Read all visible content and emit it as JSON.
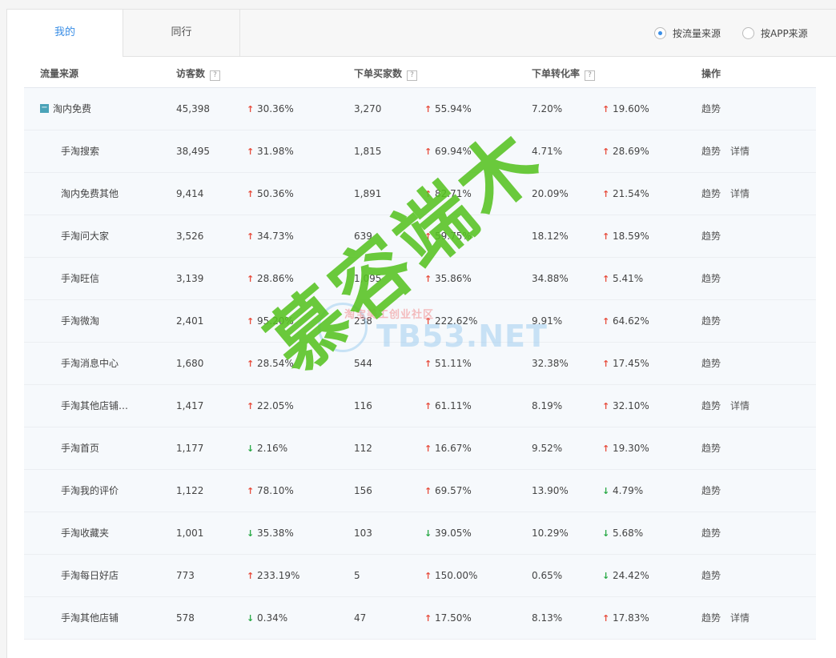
{
  "tabs": [
    {
      "label": "我的"
    },
    {
      "label": "同行"
    }
  ],
  "radios": [
    {
      "label": "按流量来源",
      "checked": true
    },
    {
      "label": "按APP来源",
      "checked": false
    }
  ],
  "table": {
    "headers": [
      "流量来源",
      "访客数",
      "下单买家数",
      "下单转化率",
      "操作"
    ],
    "help_icon": "?",
    "rows": [
      {
        "name": "淘内免费",
        "visitors": "45,398",
        "visitors_change": "30.36%",
        "visitors_dir": "up",
        "buyers": "3,270",
        "buyers_change": "55.94%",
        "buyers_dir": "up",
        "rate": "7.20%",
        "rate_change": "19.60%",
        "rate_dir": "up",
        "op1": "趋势",
        "op2": ""
      },
      {
        "name": "手淘搜索",
        "visitors": "38,495",
        "visitors_change": "31.98%",
        "visitors_dir": "up",
        "buyers": "1,815",
        "buyers_change": "69.94%",
        "buyers_dir": "up",
        "rate": "4.71%",
        "rate_change": "28.69%",
        "rate_dir": "up",
        "op1": "趋势",
        "op2": "详情"
      },
      {
        "name": "淘内免费其他",
        "visitors": "9,414",
        "visitors_change": "50.36%",
        "visitors_dir": "up",
        "buyers": "1,891",
        "buyers_change": "82.71%",
        "buyers_dir": "up",
        "rate": "20.09%",
        "rate_change": "21.54%",
        "rate_dir": "up",
        "op1": "趋势",
        "op2": "详情"
      },
      {
        "name": "手淘问大家",
        "visitors": "3,526",
        "visitors_change": "34.73%",
        "visitors_dir": "up",
        "buyers": "639",
        "buyers_change": "59.75%",
        "buyers_dir": "up",
        "rate": "18.12%",
        "rate_change": "18.59%",
        "rate_dir": "up",
        "op1": "趋势",
        "op2": ""
      },
      {
        "name": "手淘旺信",
        "visitors": "3,139",
        "visitors_change": "28.86%",
        "visitors_dir": "up",
        "buyers": "1,095",
        "buyers_change": "35.86%",
        "buyers_dir": "up",
        "rate": "34.88%",
        "rate_change": "5.41%",
        "rate_dir": "up",
        "op1": "趋势",
        "op2": ""
      },
      {
        "name": "手淘微淘",
        "visitors": "2,401",
        "visitors_change": "95.20%",
        "visitors_dir": "up",
        "buyers": "238",
        "buyers_change": "222.62%",
        "buyers_dir": "up",
        "rate": "9.91%",
        "rate_change": "64.62%",
        "rate_dir": "up",
        "op1": "趋势",
        "op2": ""
      },
      {
        "name": "手淘消息中心",
        "visitors": "1,680",
        "visitors_change": "28.54%",
        "visitors_dir": "up",
        "buyers": "544",
        "buyers_change": "51.11%",
        "buyers_dir": "up",
        "rate": "32.38%",
        "rate_change": "17.45%",
        "rate_dir": "up",
        "op1": "趋势",
        "op2": ""
      },
      {
        "name": "手淘其他店铺…",
        "visitors": "1,417",
        "visitors_change": "22.05%",
        "visitors_dir": "up",
        "buyers": "116",
        "buyers_change": "61.11%",
        "buyers_dir": "up",
        "rate": "8.19%",
        "rate_change": "32.10%",
        "rate_dir": "up",
        "op1": "趋势",
        "op2": "详情"
      },
      {
        "name": "手淘首页",
        "visitors": "1,177",
        "visitors_change": "2.16%",
        "visitors_dir": "down",
        "buyers": "112",
        "buyers_change": "16.67%",
        "buyers_dir": "up",
        "rate": "9.52%",
        "rate_change": "19.30%",
        "rate_dir": "up",
        "op1": "趋势",
        "op2": ""
      },
      {
        "name": "手淘我的评价",
        "visitors": "1,122",
        "visitors_change": "78.10%",
        "visitors_dir": "up",
        "buyers": "156",
        "buyers_change": "69.57%",
        "buyers_dir": "up",
        "rate": "13.90%",
        "rate_change": "4.79%",
        "rate_dir": "down",
        "op1": "趋势",
        "op2": ""
      },
      {
        "name": "手淘收藏夹",
        "visitors": "1,001",
        "visitors_change": "35.38%",
        "visitors_dir": "down",
        "buyers": "103",
        "buyers_change": "39.05%",
        "buyers_dir": "down",
        "rate": "10.29%",
        "rate_change": "5.68%",
        "rate_dir": "down",
        "op1": "趋势",
        "op2": ""
      },
      {
        "name": "手淘每日好店",
        "visitors": "773",
        "visitors_change": "233.19%",
        "visitors_dir": "up",
        "buyers": "5",
        "buyers_change": "150.00%",
        "buyers_dir": "up",
        "rate": "0.65%",
        "rate_change": "24.42%",
        "rate_dir": "down",
        "op1": "趋势",
        "op2": ""
      },
      {
        "name": "手淘其他店铺",
        "visitors": "578",
        "visitors_change": "0.34%",
        "visitors_dir": "down",
        "buyers": "47",
        "buyers_change": "17.50%",
        "buyers_dir": "up",
        "rate": "8.13%",
        "rate_change": "17.83%",
        "rate_dir": "up",
        "op1": "趋势",
        "op2": "详情"
      }
    ]
  },
  "watermark": {
    "main": "慕容端木",
    "site_cn": "淘宝美工创业社区",
    "site_en": "TB53.NET"
  },
  "colors": {
    "up": "#e74c3c",
    "down": "#27a844",
    "accent": "#3a8ee6"
  }
}
